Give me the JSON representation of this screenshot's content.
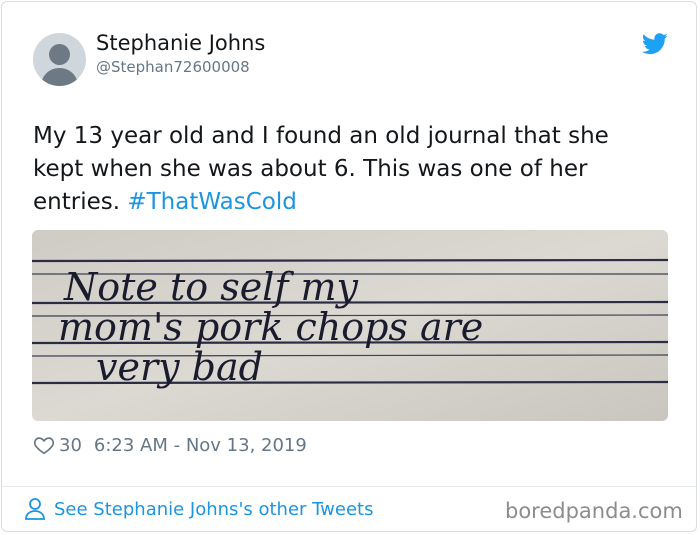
{
  "tweet": {
    "author_name": "Stephanie Johns",
    "author_handle": "@Stephan72600008",
    "text_main": "My 13 year old and I found an old journal that she kept when she was about 6. This was one of her entries. ",
    "hashtag": "#ThatWasCold",
    "likes": "30",
    "timestamp": "6:23 AM - Nov 13, 2019"
  },
  "photo": {
    "line1": "Note to self   my",
    "line2": "mom's   pork chops  are",
    "line3": "very   bad"
  },
  "footer": {
    "link_text": "See Stephanie Johns's other Tweets",
    "watermark": "boredpanda.com"
  },
  "colors": {
    "link": "#1b95e0",
    "muted": "#657786",
    "paper": "#d6d2cc"
  },
  "icons": {
    "brand": "twitter-bird-icon",
    "like": "heart-icon",
    "profile": "person-icon"
  }
}
